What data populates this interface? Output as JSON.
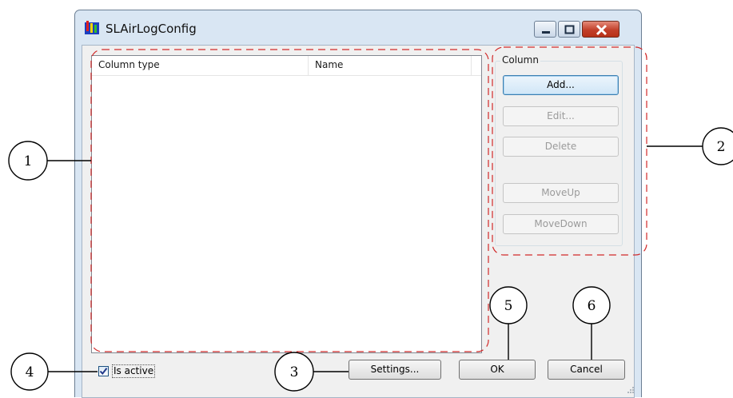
{
  "window": {
    "title": "SLAirLogConfig",
    "app_icon": "slairlog-app-icon",
    "controls": [
      "minimize-icon",
      "maximize-icon",
      "close-icon"
    ]
  },
  "listview": {
    "columns": [
      "Column type",
      "Name"
    ],
    "rows": []
  },
  "column_group": {
    "label": "Column",
    "buttons": [
      {
        "label": "Add...",
        "enabled": true
      },
      {
        "label": "Edit...",
        "enabled": false
      },
      {
        "label": "Delete",
        "enabled": false
      },
      {
        "label": "MoveUp",
        "enabled": false
      },
      {
        "label": "MoveDown",
        "enabled": false
      }
    ]
  },
  "is_active": {
    "label": "Is active",
    "checked": true
  },
  "footer": {
    "settings_label": "Settings...",
    "ok_label": "OK",
    "cancel_label": "Cancel"
  },
  "callouts": [
    "1",
    "2",
    "3",
    "4",
    "5",
    "6"
  ],
  "colors": {
    "callout_dash": "#d12a2a",
    "default_button_border": "#3c7fb1",
    "close_button": "#c2402a"
  }
}
